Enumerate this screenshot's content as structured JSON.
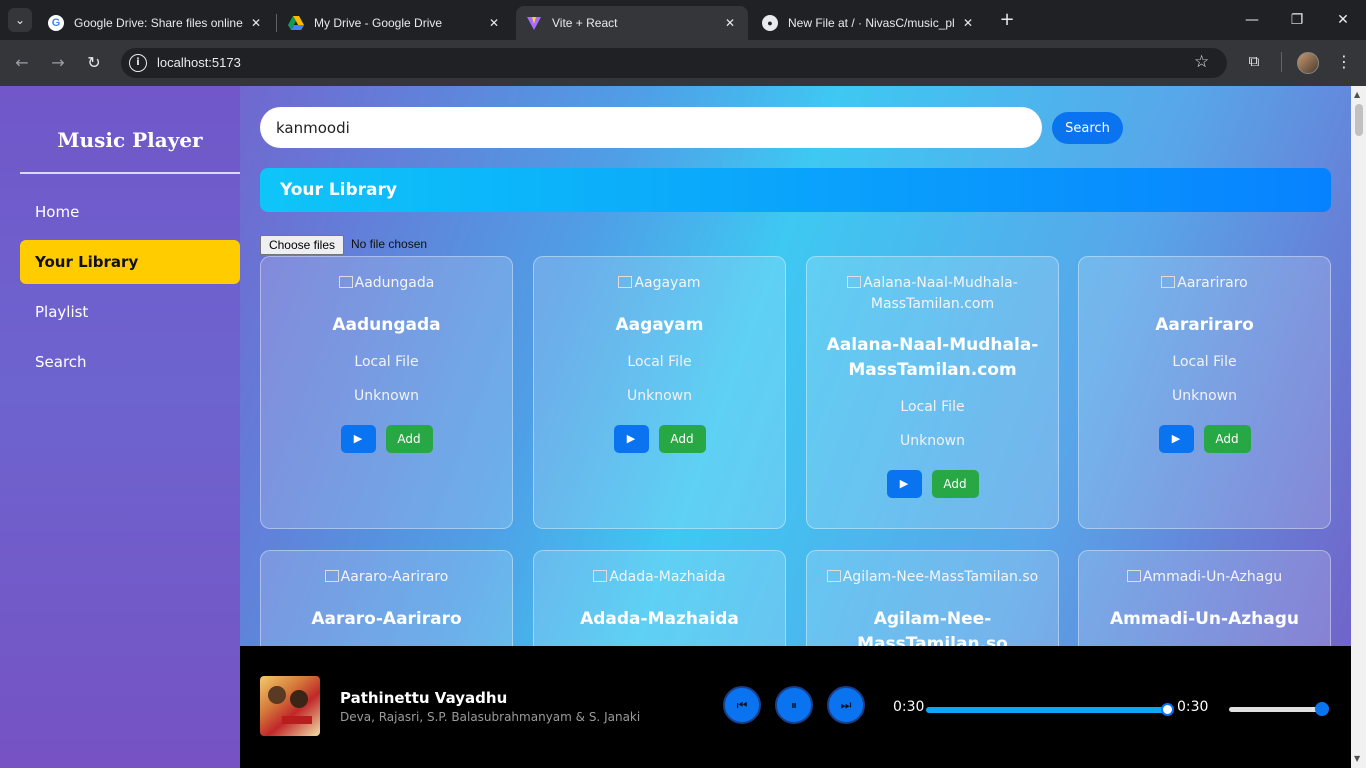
{
  "browser": {
    "tabs": [
      {
        "title": "Google Drive: Share files online",
        "icon": "google-icon"
      },
      {
        "title": "My Drive - Google Drive",
        "icon": "google-drive-icon"
      },
      {
        "title": "Vite + React",
        "icon": "vite-icon"
      },
      {
        "title": "New File at / · NivasC/music_pl",
        "icon": "github-icon"
      }
    ],
    "active_tab": 2,
    "url": "localhost:5173"
  },
  "sidebar": {
    "brand": "Music Player",
    "items": [
      {
        "label": "Home"
      },
      {
        "label": "Your Library"
      },
      {
        "label": "Playlist"
      },
      {
        "label": "Search"
      }
    ],
    "active_index": 1
  },
  "search": {
    "value": "kanmoodi",
    "button_label": "Search"
  },
  "library": {
    "title": "Your Library",
    "file_button": "Choose files",
    "file_status": "No file chosen"
  },
  "cards": [
    {
      "alt": "Aadungada",
      "title": "Aadungada",
      "source": "Local File",
      "artist": "Unknown",
      "play_label": "▶",
      "add_label": "Add"
    },
    {
      "alt": "Aagayam",
      "title": "Aagayam",
      "source": "Local File",
      "artist": "Unknown",
      "play_label": "▶",
      "add_label": "Add"
    },
    {
      "alt": "Aalana-Naal-Mudhala-MassTamilan.com",
      "title": "Aalana-Naal-Mudhala-MassTamilan.com",
      "source": "Local File",
      "artist": "Unknown",
      "play_label": "▶",
      "add_label": "Add"
    },
    {
      "alt": "Aarariraro",
      "title": "Aarariraro",
      "source": "Local File",
      "artist": "Unknown",
      "play_label": "▶",
      "add_label": "Add"
    },
    {
      "alt": "Aararo-Aariraro",
      "title": "Aararo-Aariraro"
    },
    {
      "alt": "Adada-Mazhaida",
      "title": "Adada-Mazhaida"
    },
    {
      "alt": "Agilam-Nee-MassTamilan.so",
      "title": "Agilam-Nee-MassTamilan.so"
    },
    {
      "alt": "Ammadi-Un-Azhagu",
      "title": "Ammadi-Un-Azhagu"
    }
  ],
  "player": {
    "song": "Pathinettu Vayadhu",
    "artists": "Deva, Rajasri, S.P. Balasubrahmanyam & S. Janaki",
    "prev_label": "⏮",
    "pause_label": "⏸",
    "next_label": "⏭",
    "current_time": "0:30",
    "duration": "0:30",
    "progress": 1.0,
    "volume": 1.0,
    "accent": "#0a74f0"
  },
  "colors": {
    "active_nav": "#ffcc00",
    "play_button": "#0a74f0",
    "add_button": "#28a745",
    "search_button": "#0a74f0"
  }
}
